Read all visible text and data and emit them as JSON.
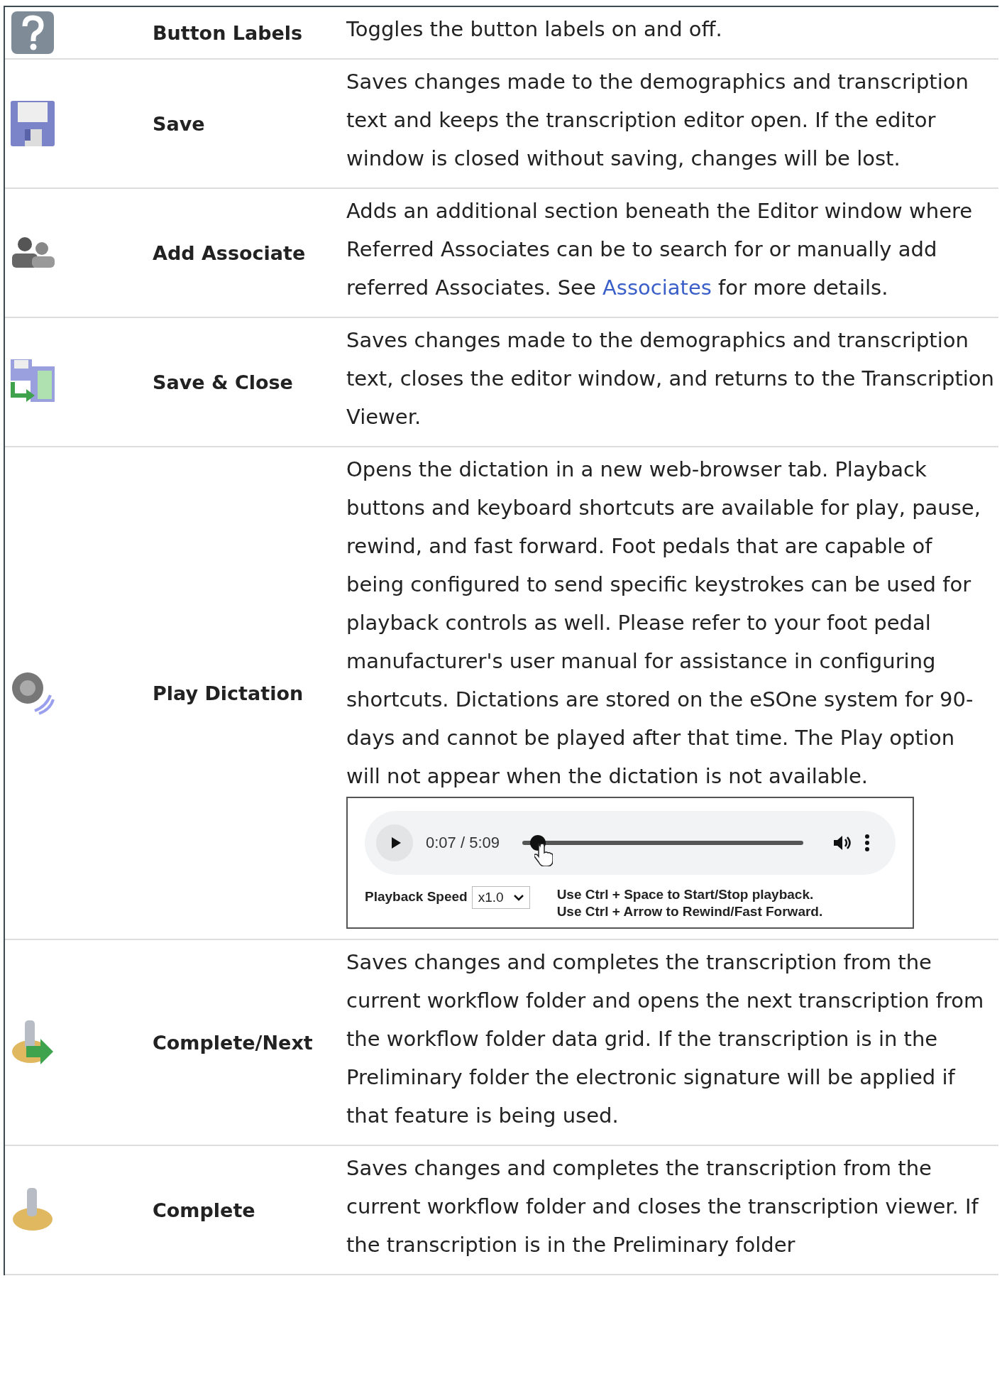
{
  "rows": [
    {
      "name": "Button Labels",
      "description": [
        {
          "kind": "text",
          "text": "Toggles the button labels on and off."
        }
      ]
    },
    {
      "name": "Save",
      "description": [
        {
          "kind": "text",
          "text": "Saves changes made to the demographics and transcription text and keeps the transcription editor open. If the editor window is closed without saving, changes will be lost."
        }
      ]
    },
    {
      "name": "Add Associate",
      "description": [
        {
          "kind": "text",
          "text": "Adds an additional section beneath the Editor window where Referred Associates can be to search for or manually add referred Associates. See "
        },
        {
          "kind": "link",
          "text": "Associates"
        },
        {
          "kind": "text",
          "text": " for more details."
        }
      ]
    },
    {
      "name": "Save & Close",
      "description": [
        {
          "kind": "text",
          "text": "Saves changes made to the demographics and transcription text, closes the editor window, and returns to the Transcription Viewer."
        }
      ]
    },
    {
      "name": "Play Dictation",
      "description": [
        {
          "kind": "text",
          "text": "Opens the dictation in a new web-browser tab. Playback buttons and keyboard shortcuts are available for play, pause, rewind, and fast forward. Foot pedals that are capable of being configured to send specific keystrokes can be used for playback controls as well. Please refer to your foot pedal manufacturer's user manual for assistance in configuring shortcuts. Dictations are stored on the eSOne system for 90-days and cannot be played after that time. The Play option will not appear when the dictation is not available."
        }
      ],
      "player": {
        "time": "0:07 / 5:09",
        "level": 0.03,
        "speed_label": "Playback Speed",
        "speed_value": "x1.0",
        "hints": [
          "Use Ctrl + Space to Start/Stop playback.",
          "Use Ctrl + Arrow to Rewind/Fast Forward."
        ]
      }
    },
    {
      "name": "Complete/Next",
      "description": [
        {
          "kind": "text",
          "text": "Saves changes and completes the transcription from the current workflow folder and opens the next transcription from the workflow folder data grid. If the transcription is in the Preliminary folder the electronic signature will be applied if that feature is being used."
        }
      ]
    },
    {
      "name": "Complete",
      "description": [
        {
          "kind": "text",
          "text": "Saves changes and completes the transcription from the current workflow folder and closes the transcription viewer. If the transcription is in the Preliminary folder"
        }
      ]
    }
  ]
}
